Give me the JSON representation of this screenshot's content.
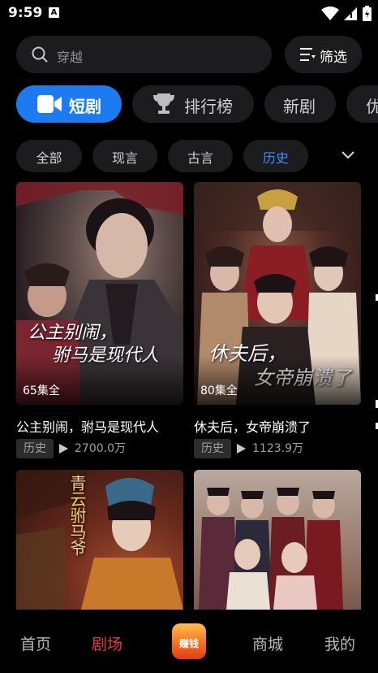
{
  "status_bar": {
    "time": "9:59",
    "notif_letter": "A"
  },
  "search": {
    "placeholder": "穿越",
    "filter_label": "筛选"
  },
  "tabs": [
    {
      "label": "短剧",
      "icon": "video-camera-icon",
      "active": true
    },
    {
      "label": "排行榜",
      "icon": "trophy-icon",
      "active": false
    },
    {
      "label": "新剧",
      "active": false
    },
    {
      "label": "优",
      "active": false
    }
  ],
  "chips": [
    {
      "label": "全部",
      "active": false
    },
    {
      "label": "现言",
      "active": false
    },
    {
      "label": "古言",
      "active": false
    },
    {
      "label": "历史",
      "active": true
    }
  ],
  "dramas": [
    {
      "title": "公主别闹，驸马是现代人",
      "poster_text": "公主别闹，驸马是现代人",
      "episodes": "65集全",
      "tag": "历史",
      "views": "2700.0万"
    },
    {
      "title": "休夫后，女帝崩溃了",
      "poster_text": "休夫后，女帝崩溃了",
      "episodes": "80集全",
      "tag": "历史",
      "views": "1123.9万"
    },
    {
      "title": "",
      "poster_text": "青云驸马爷"
    },
    {
      "title": "",
      "poster_text": ""
    }
  ],
  "nav": [
    {
      "label": "首页",
      "active": false
    },
    {
      "label": "剧场",
      "active": true
    },
    {
      "label": "赚钱",
      "active": false
    },
    {
      "label": "商城",
      "active": false
    },
    {
      "label": "我的",
      "active": false
    }
  ],
  "colors": {
    "accent_blue": "#1a7cf0",
    "nav_active": "#e8354a",
    "background": "#000000"
  }
}
